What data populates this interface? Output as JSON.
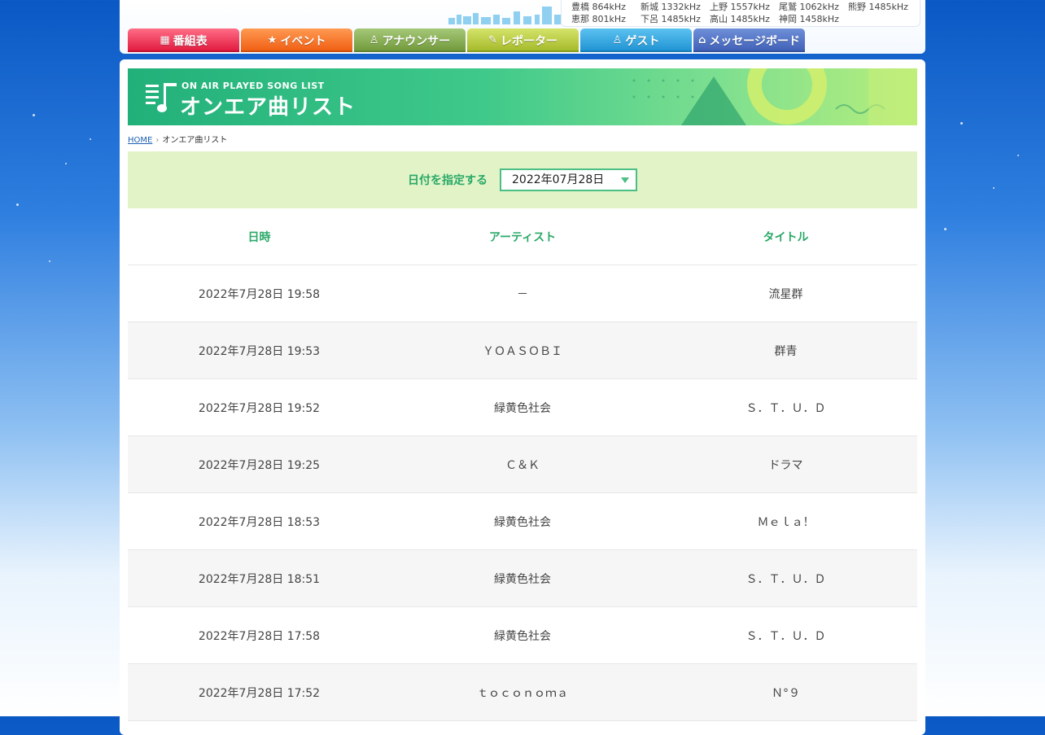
{
  "header": {
    "frequencies": [
      {
        "station": "豊橋",
        "freq": "864kHz"
      },
      {
        "station": "新城",
        "freq": "1332kHz"
      },
      {
        "station": "上野",
        "freq": "1557kHz"
      },
      {
        "station": "尾鷲",
        "freq": "1062kHz"
      },
      {
        "station": "熊野",
        "freq": "1485kHz"
      },
      {
        "station": "恵那",
        "freq": "801kHz"
      },
      {
        "station": "下呂",
        "freq": "1485kHz"
      },
      {
        "station": "高山",
        "freq": "1485kHz"
      },
      {
        "station": "神岡",
        "freq": "1458kHz"
      }
    ]
  },
  "nav": {
    "tabs": [
      {
        "label": "番組表",
        "icon": "grid-icon"
      },
      {
        "label": "イベント",
        "icon": "star-icon"
      },
      {
        "label": "アナウンサー",
        "icon": "person-icon"
      },
      {
        "label": "レポーター",
        "icon": "microphone-icon"
      },
      {
        "label": "ゲスト",
        "icon": "person-icon"
      },
      {
        "label": "メッセージボード",
        "icon": "board-icon"
      }
    ]
  },
  "banner": {
    "subtitle": "ON AIR PLAYED SONG LIST",
    "title": "オンエア曲リスト"
  },
  "breadcrumb": {
    "home": "HOME",
    "current": "オンエア曲リスト"
  },
  "datebar": {
    "label": "日付を指定する",
    "selected": "2022年07月28日"
  },
  "table": {
    "headers": [
      "日時",
      "アーティスト",
      "タイトル"
    ],
    "rows": [
      [
        "2022年7月28日 19:58",
        "－",
        "流星群"
      ],
      [
        "2022年7月28日 19:53",
        "ＹＯＡＳＯＢＩ",
        "群青"
      ],
      [
        "2022年7月28日 19:52",
        "緑黄色社会",
        "Ｓ．Ｔ．Ｕ．Ｄ"
      ],
      [
        "2022年7月28日 19:25",
        "Ｃ＆Ｋ",
        "ドラマ"
      ],
      [
        "2022年7月28日 18:53",
        "緑黄色社会",
        "Ｍｅｌａ！"
      ],
      [
        "2022年7月28日 18:51",
        "緑黄色社会",
        "Ｓ．Ｔ．Ｕ．Ｄ"
      ],
      [
        "2022年7月28日 17:58",
        "緑黄色社会",
        "Ｓ．Ｔ．Ｕ．Ｄ"
      ],
      [
        "2022年7月28日 17:52",
        "ｔｏｃｏｎｏｍａ",
        "Ｎ°９"
      ]
    ]
  }
}
